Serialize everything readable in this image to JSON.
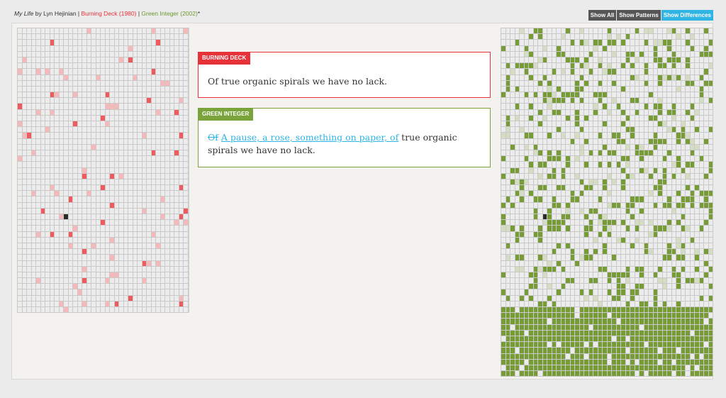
{
  "header": {
    "work_title": "My Life",
    "by_text": " by Lyn Hejinian | ",
    "edition1": "Burning Deck (1980)",
    "sep": " | ",
    "edition2": "Green Integer (2002)",
    "asterisk": "*"
  },
  "buttons": {
    "show_all": "Show All",
    "show_patterns": "Show Patterns",
    "show_differences": "Show Differences"
  },
  "colors": {
    "burning_deck": "#e8323a",
    "green_integer": "#7aa33b",
    "diff_highlight": "#2fb4e3"
  },
  "burning_deck": {
    "label": "BURNING DECK",
    "text": "Of true organic spirals we have no lack."
  },
  "green_integer": {
    "label": "GREEN INTEGER",
    "deleted": "Of",
    "inserted": "A pause, a rose, something on paper, of",
    "rest": " true organic spirals we have no lack."
  }
}
